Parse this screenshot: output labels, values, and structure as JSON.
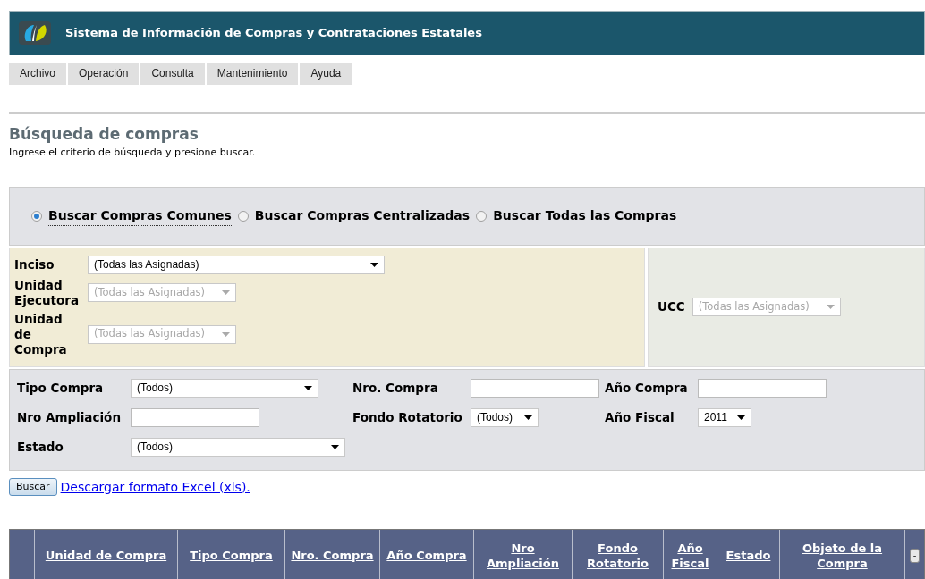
{
  "header": {
    "title": "Sistema de Información de Compras y Contrataciones Estatales"
  },
  "menu": [
    {
      "label": "Archivo"
    },
    {
      "label": "Operación"
    },
    {
      "label": "Consulta"
    },
    {
      "label": "Mantenimiento"
    },
    {
      "label": "Ayuda"
    }
  ],
  "page": {
    "title": "Búsqueda de compras",
    "subtitle": "Ingrese el criterio de búsqueda y presione buscar."
  },
  "search_modes": [
    {
      "label": "Buscar Compras Comunes",
      "selected": true
    },
    {
      "label": "Buscar Compras Centralizadas",
      "selected": false
    },
    {
      "label": "Buscar Todas las Compras",
      "selected": false
    }
  ],
  "scope": {
    "left": [
      {
        "label": "Inciso",
        "value": "(Todas las Asignadas)",
        "disabled": false
      },
      {
        "label": "Unidad Ejecutora",
        "value": "(Todas las Asignadas)",
        "disabled": true
      },
      {
        "label": "Unidad de Compra",
        "value": "(Todas las Asignadas)",
        "disabled": true
      }
    ],
    "right": [
      {
        "label": "UCC",
        "value": "(Todas las Asignadas)",
        "disabled": true
      }
    ]
  },
  "filters": [
    {
      "label": "Tipo Compra",
      "kind": "select",
      "value": "(Todos)"
    },
    {
      "label": "Nro. Compra",
      "kind": "input"
    },
    {
      "label": "Año Compra",
      "kind": "input"
    },
    {
      "label": "Nro Ampliación",
      "kind": "input"
    },
    {
      "label": "Fondo Rotatorio",
      "kind": "select",
      "value": "(Todos)"
    },
    {
      "label": "Año Fiscal",
      "kind": "select",
      "value": "2011"
    },
    {
      "label": "Estado",
      "kind": "select",
      "value": "(Todos)"
    }
  ],
  "actions": {
    "button": "Buscar",
    "link": "Descargar formato Excel (xls)."
  },
  "table": {
    "columns": [
      "Unidad de Compra",
      "Tipo Compra",
      "Nro. Compra",
      "Año Compra",
      "Nro Ampliación",
      "Fondo Rotatorio",
      "Año Fiscal",
      "Estado",
      "Objeto de la Compra"
    ],
    "collapse_button": "-"
  }
}
